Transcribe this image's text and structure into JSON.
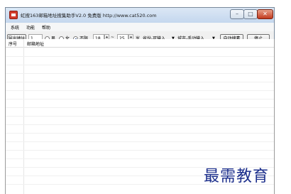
{
  "window": {
    "title": "虹搜163邮箱地址搜集助手V2.0 免费版     http://www.cat520.com",
    "controls": {
      "minimize": "–",
      "maximize": "□",
      "close": "✕"
    }
  },
  "menu": [
    "系统",
    "功能",
    "帮助"
  ],
  "toolbar": {
    "export_label": "导出地址",
    "count_value": "1",
    "gender_options": [
      {
        "label": "男",
        "selected": false
      },
      {
        "label": "女",
        "selected": false
      },
      {
        "label": "不限",
        "selected": true
      }
    ],
    "age_min": "18",
    "age_sep": "~",
    "age_max": "25",
    "age_unit": "岁",
    "province_value": "省份-可输入",
    "city_value": "城市-手动输入",
    "auto_search_label": "自动搜素",
    "stop_label": "停止"
  },
  "table": {
    "columns": [
      "序号",
      "邮箱地址"
    ],
    "rows": []
  },
  "watermark": "最需教育",
  "colors": {
    "title_bar": "#c4d7ee",
    "close_button": "#c23a1e",
    "watermark": "#1c2f8c"
  }
}
